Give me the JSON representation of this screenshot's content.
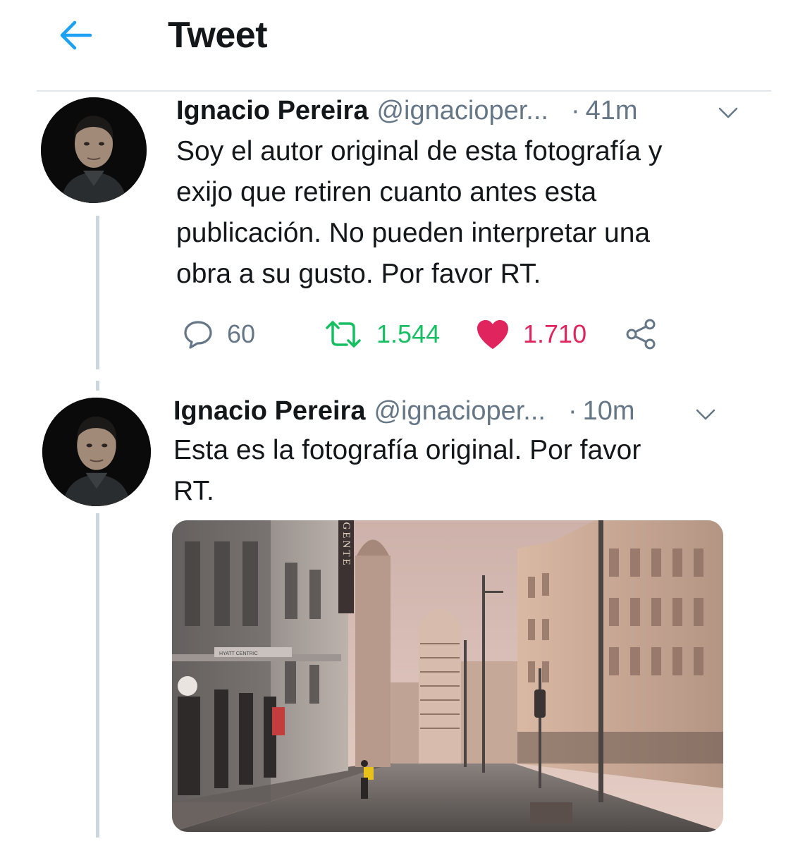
{
  "header": {
    "title": "Tweet",
    "back_icon": "arrow-left-icon"
  },
  "colors": {
    "accent": "#1da1f2",
    "retweet": "#17bf63",
    "like": "#e0245e",
    "secondary": "#657786"
  },
  "tweets": [
    {
      "name": "Ignacio Pereira",
      "handle": "@ignacioper...",
      "dot": "·",
      "time": "41m",
      "text": "Soy el autor original de esta fotografía y\nexijo que retiren cuanto antes  esta\npublicación. No pueden interpretar una\nobra a su gusto. Por favor RT.",
      "actions": {
        "replies": "60",
        "retweets": "1.544",
        "likes": "1.710"
      }
    },
    {
      "name": "Ignacio Pereira",
      "handle": "@ignacioper...",
      "dot": "·",
      "time": "10m",
      "text": "Esta es la fotografía original. Por favor\nRT.",
      "media": {
        "sign_text": "REGENTE",
        "awning_text": "HYATT CENTRIC"
      }
    }
  ]
}
